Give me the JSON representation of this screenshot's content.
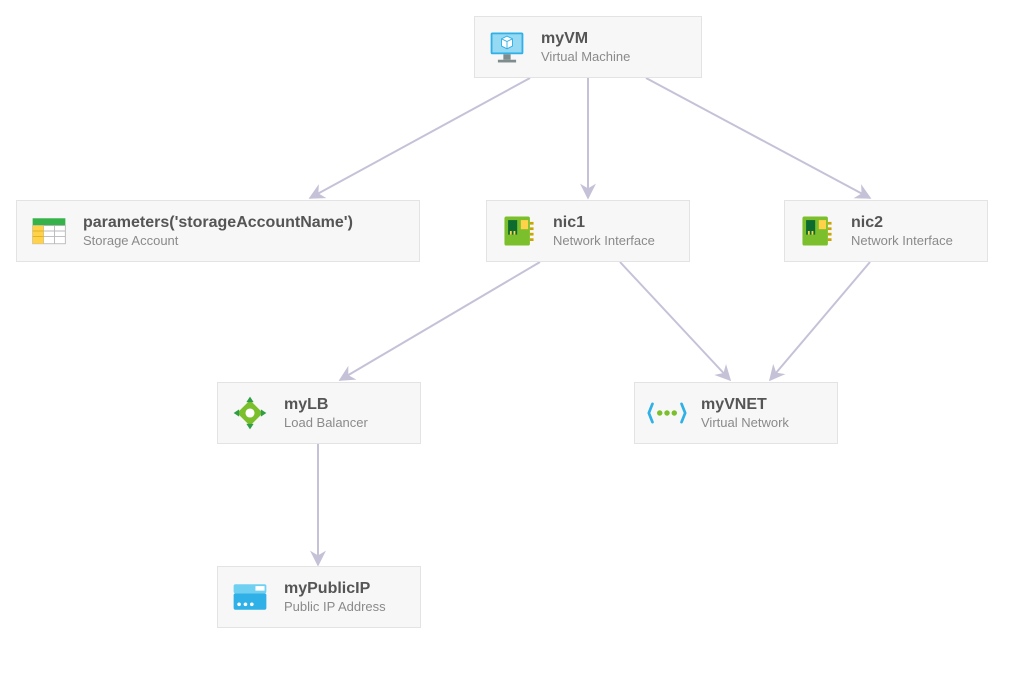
{
  "diagram": {
    "nodes": {
      "vm": {
        "title": "myVM",
        "subtitle": "Virtual Machine",
        "icon": "vm-icon"
      },
      "storage": {
        "title": "parameters('storageAccountName')",
        "subtitle": "Storage Account",
        "icon": "storage-icon"
      },
      "nic1": {
        "title": "nic1",
        "subtitle": "Network Interface",
        "icon": "nic-icon"
      },
      "nic2": {
        "title": "nic2",
        "subtitle": "Network Interface",
        "icon": "nic-icon"
      },
      "lb": {
        "title": "myLB",
        "subtitle": "Load Balancer",
        "icon": "loadbalancer-icon"
      },
      "vnet": {
        "title": "myVNET",
        "subtitle": "Virtual Network",
        "icon": "vnet-icon"
      },
      "pip": {
        "title": "myPublicIP",
        "subtitle": "Public IP Address",
        "icon": "publicip-icon"
      }
    },
    "edges": [
      {
        "from": "vm",
        "to": "storage"
      },
      {
        "from": "vm",
        "to": "nic1"
      },
      {
        "from": "vm",
        "to": "nic2"
      },
      {
        "from": "nic1",
        "to": "lb"
      },
      {
        "from": "nic1",
        "to": "vnet"
      },
      {
        "from": "nic2",
        "to": "vnet"
      },
      {
        "from": "lb",
        "to": "pip"
      }
    ]
  },
  "colors": {
    "arrow": "#c5c2d8",
    "node_bg": "#f7f7f7",
    "node_border": "#e3e3e3"
  }
}
